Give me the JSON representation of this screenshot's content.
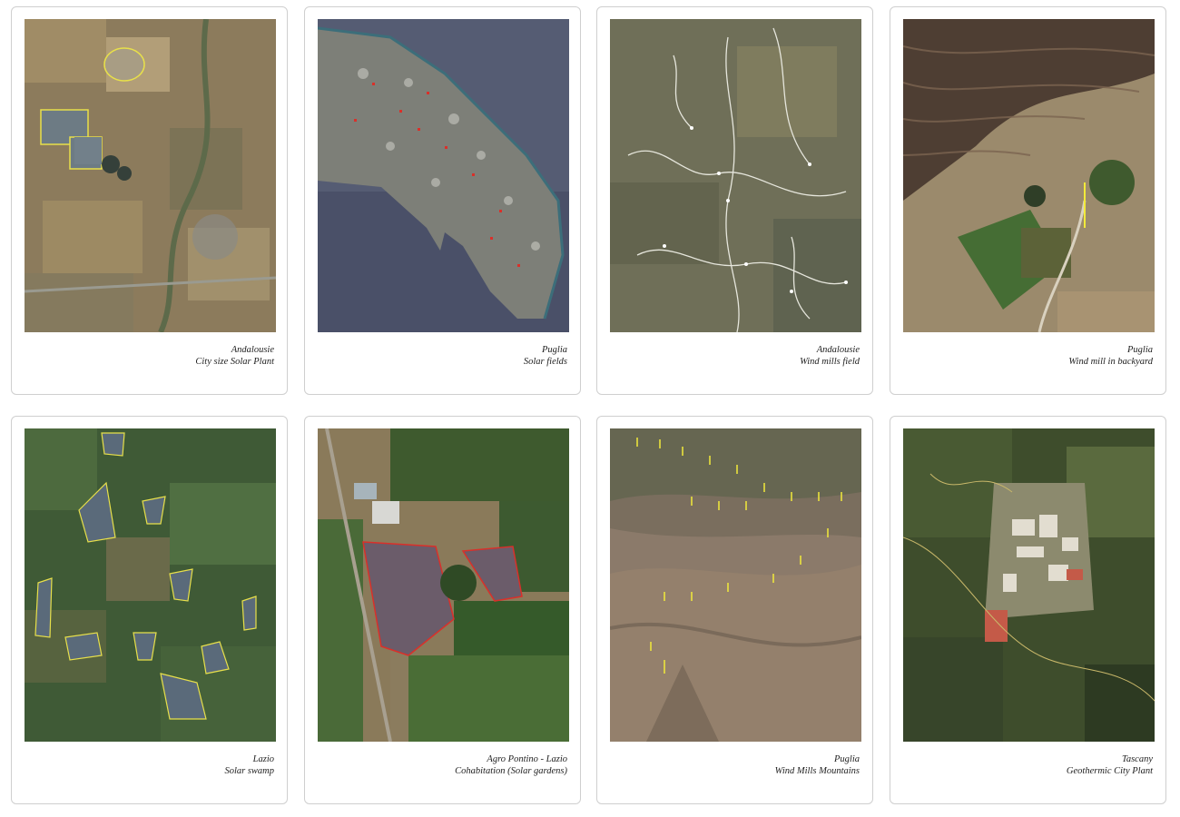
{
  "cards": [
    {
      "place": "Andalousie",
      "subject": "City size Solar Plant",
      "image": "aerial-solar-plant-andalousie"
    },
    {
      "place": "Puglia",
      "subject": "Solar fields",
      "image": "satellite-puglia-peninsula"
    },
    {
      "place": "Andalousie",
      "subject": "Wind mills field",
      "image": "aerial-wind-mills-andalousie"
    },
    {
      "place": "Puglia",
      "subject": "Wind mill in backyard",
      "image": "aerial-wind-mill-backyard-puglia"
    },
    {
      "place": "Lazio",
      "subject": "Solar swamp",
      "image": "aerial-solar-swamp-lazio"
    },
    {
      "place": "Agro Pontino - Lazio",
      "subject": "Cohabitation (Solar gardens)",
      "image": "aerial-solar-gardens-agro-pontino"
    },
    {
      "place": "Puglia",
      "subject": "Wind Mills Mountains",
      "image": "aerial-wind-mills-mountains-puglia"
    },
    {
      "place": "Tascany",
      "subject": "Geothermic City Plant",
      "image": "aerial-geothermic-plant-tuscany"
    }
  ],
  "colors": {
    "solar_outline": "#e8e04a",
    "red_outline": "#d9302a",
    "turbine": "#f2ea3a"
  }
}
